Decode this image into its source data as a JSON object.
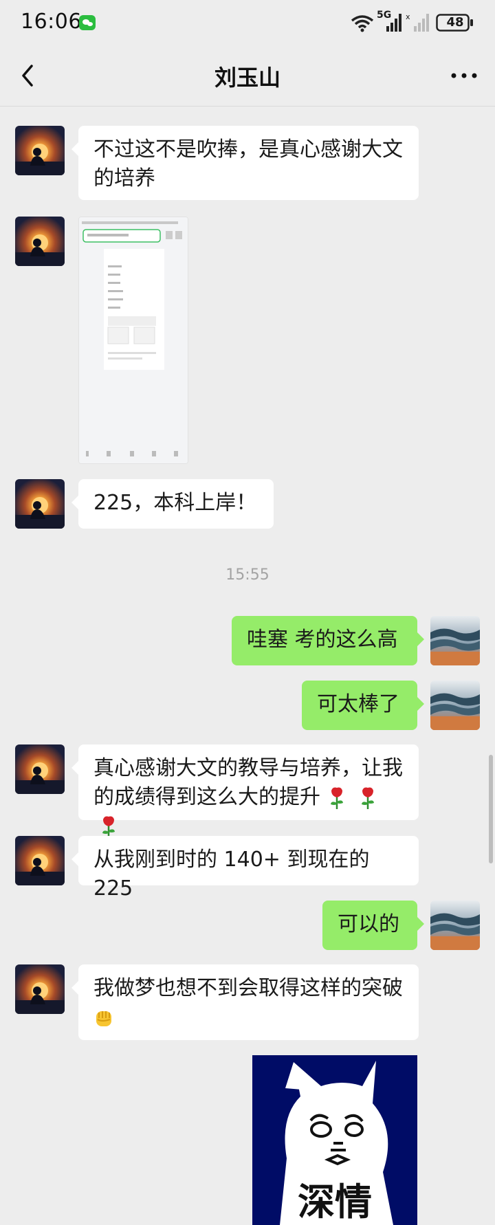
{
  "status_bar": {
    "time": "16:06",
    "network": "5G",
    "battery": "48",
    "icons": [
      "wechat-notification-icon",
      "wifi-icon",
      "signal-icon",
      "signal-icon-no-sim",
      "battery-icon"
    ]
  },
  "header": {
    "title": "刘玉山",
    "back_icon": "chevron-left-icon",
    "more_icon": "more-dots-icon"
  },
  "messages": [
    {
      "side": "left",
      "type": "text",
      "lines": [
        "不过这不是吹捧，是真心感谢大文",
        "的培养"
      ]
    },
    {
      "side": "left",
      "type": "image",
      "description_icon": "screenshot-thumbnail"
    },
    {
      "side": "left",
      "type": "text",
      "lines": [
        "225，本科上岸！"
      ]
    },
    {
      "type": "timestamp",
      "text": "15:55"
    },
    {
      "side": "right",
      "type": "text",
      "lines": [
        "哇塞 考的这么高"
      ]
    },
    {
      "side": "right",
      "type": "text",
      "lines": [
        "可太棒了"
      ]
    },
    {
      "side": "left",
      "type": "text",
      "lines": [
        "真心感谢大文的教导与培养，让我",
        "的成绩得到这么大的提升"
      ],
      "emoji": [
        "rose-icon",
        "rose-icon",
        "rose-icon"
      ]
    },
    {
      "side": "left",
      "type": "text",
      "lines": [
        "从我刚到时的 140+ 到现在的 225"
      ]
    },
    {
      "side": "right",
      "type": "text",
      "lines": [
        "可以的"
      ]
    },
    {
      "side": "left",
      "type": "text",
      "lines": [
        "我做梦也想不到会取得这样的突破"
      ],
      "emoji": [
        "fist-icon"
      ]
    },
    {
      "side": "right",
      "type": "sticker",
      "text": "深情"
    }
  ],
  "colors": {
    "background": "#ededed",
    "bubble_left": "#ffffff",
    "bubble_right": "#95ec69",
    "sticker_bg": "#000c66",
    "timestamp": "#a3a3a3"
  }
}
